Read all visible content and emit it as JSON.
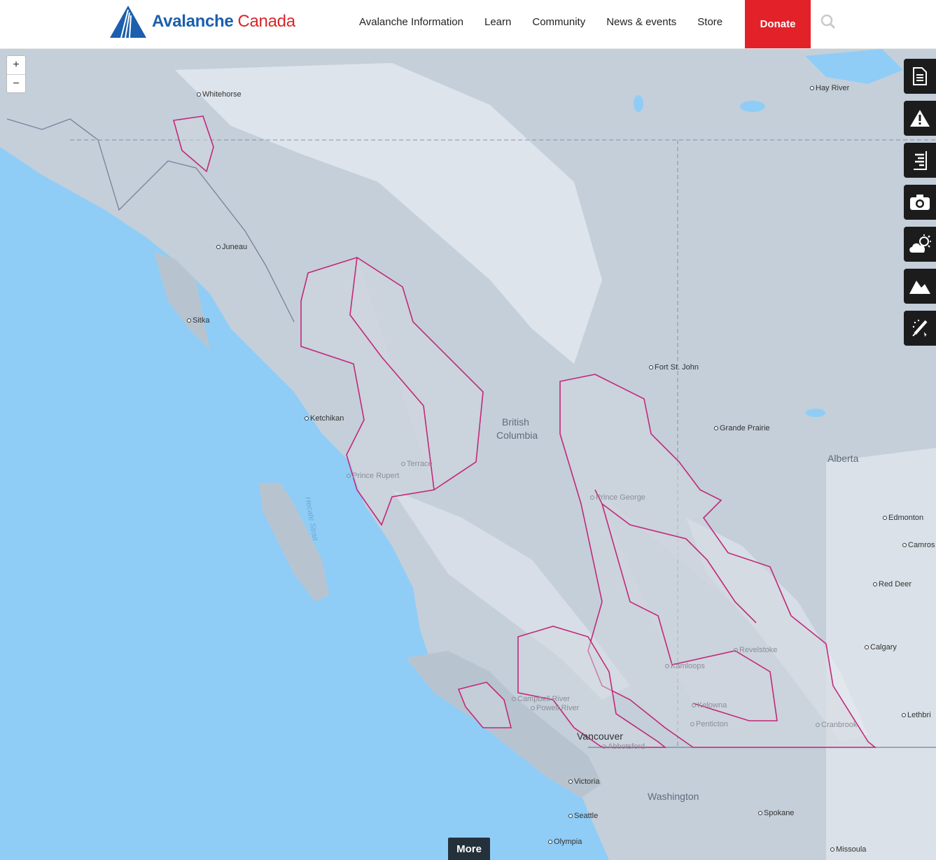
{
  "header": {
    "logo_word1": "Avalanche",
    "logo_word2": "Canada",
    "nav": [
      "Avalanche Information",
      "Learn",
      "Community",
      "News & events",
      "Store"
    ],
    "donate": "Donate"
  },
  "map": {
    "zoom_in": "+",
    "zoom_out": "−",
    "more": "More",
    "colors": {
      "ocean": "#8fcdf7",
      "land": "#c4cfda",
      "forecast_region_border": "#c2287a",
      "snow": "#eef1f6"
    },
    "tools": [
      "document-icon",
      "warning-icon",
      "list-icon",
      "camera-icon",
      "weather-icon",
      "mountain-icon",
      "pencil-icon"
    ],
    "cities": {
      "whitehorse": "Whitehorse",
      "juneau": "Juneau",
      "sitka": "Sitka",
      "ketchikan": "Ketchikan",
      "fort_st_john": "Fort St. John",
      "grande_prairie": "Grande Prairie",
      "hay_river": "Hay River",
      "edmonton": "Edmonton",
      "camrose": "Camros",
      "red_deer": "Red Deer",
      "calgary": "Calgary",
      "lethbridge": "Lethbri",
      "victoria": "Victoria",
      "seattle": "Seattle",
      "olympia": "Olympia",
      "spokane": "Spokane",
      "missoula": "Missoula"
    },
    "faint_cities": {
      "terrace": "Terrace",
      "prince_rupert": "Prince Rupert",
      "prince_george": "Prince George",
      "revelstoke": "Revelstoke",
      "kamloops": "Kamloops",
      "kelowna": "Kelowna",
      "penticton": "Penticton",
      "cranbrook": "Cranbrook",
      "campbell_river": "Campbell River",
      "powell_river": "Powell River",
      "abbotsford": "Abbotsford"
    },
    "vancouver": "Vancouver",
    "regions": {
      "bc1": "British",
      "bc2": "Columbia",
      "alberta": "Alberta",
      "washington": "Washington",
      "hecate": "Hecate Strait"
    }
  }
}
